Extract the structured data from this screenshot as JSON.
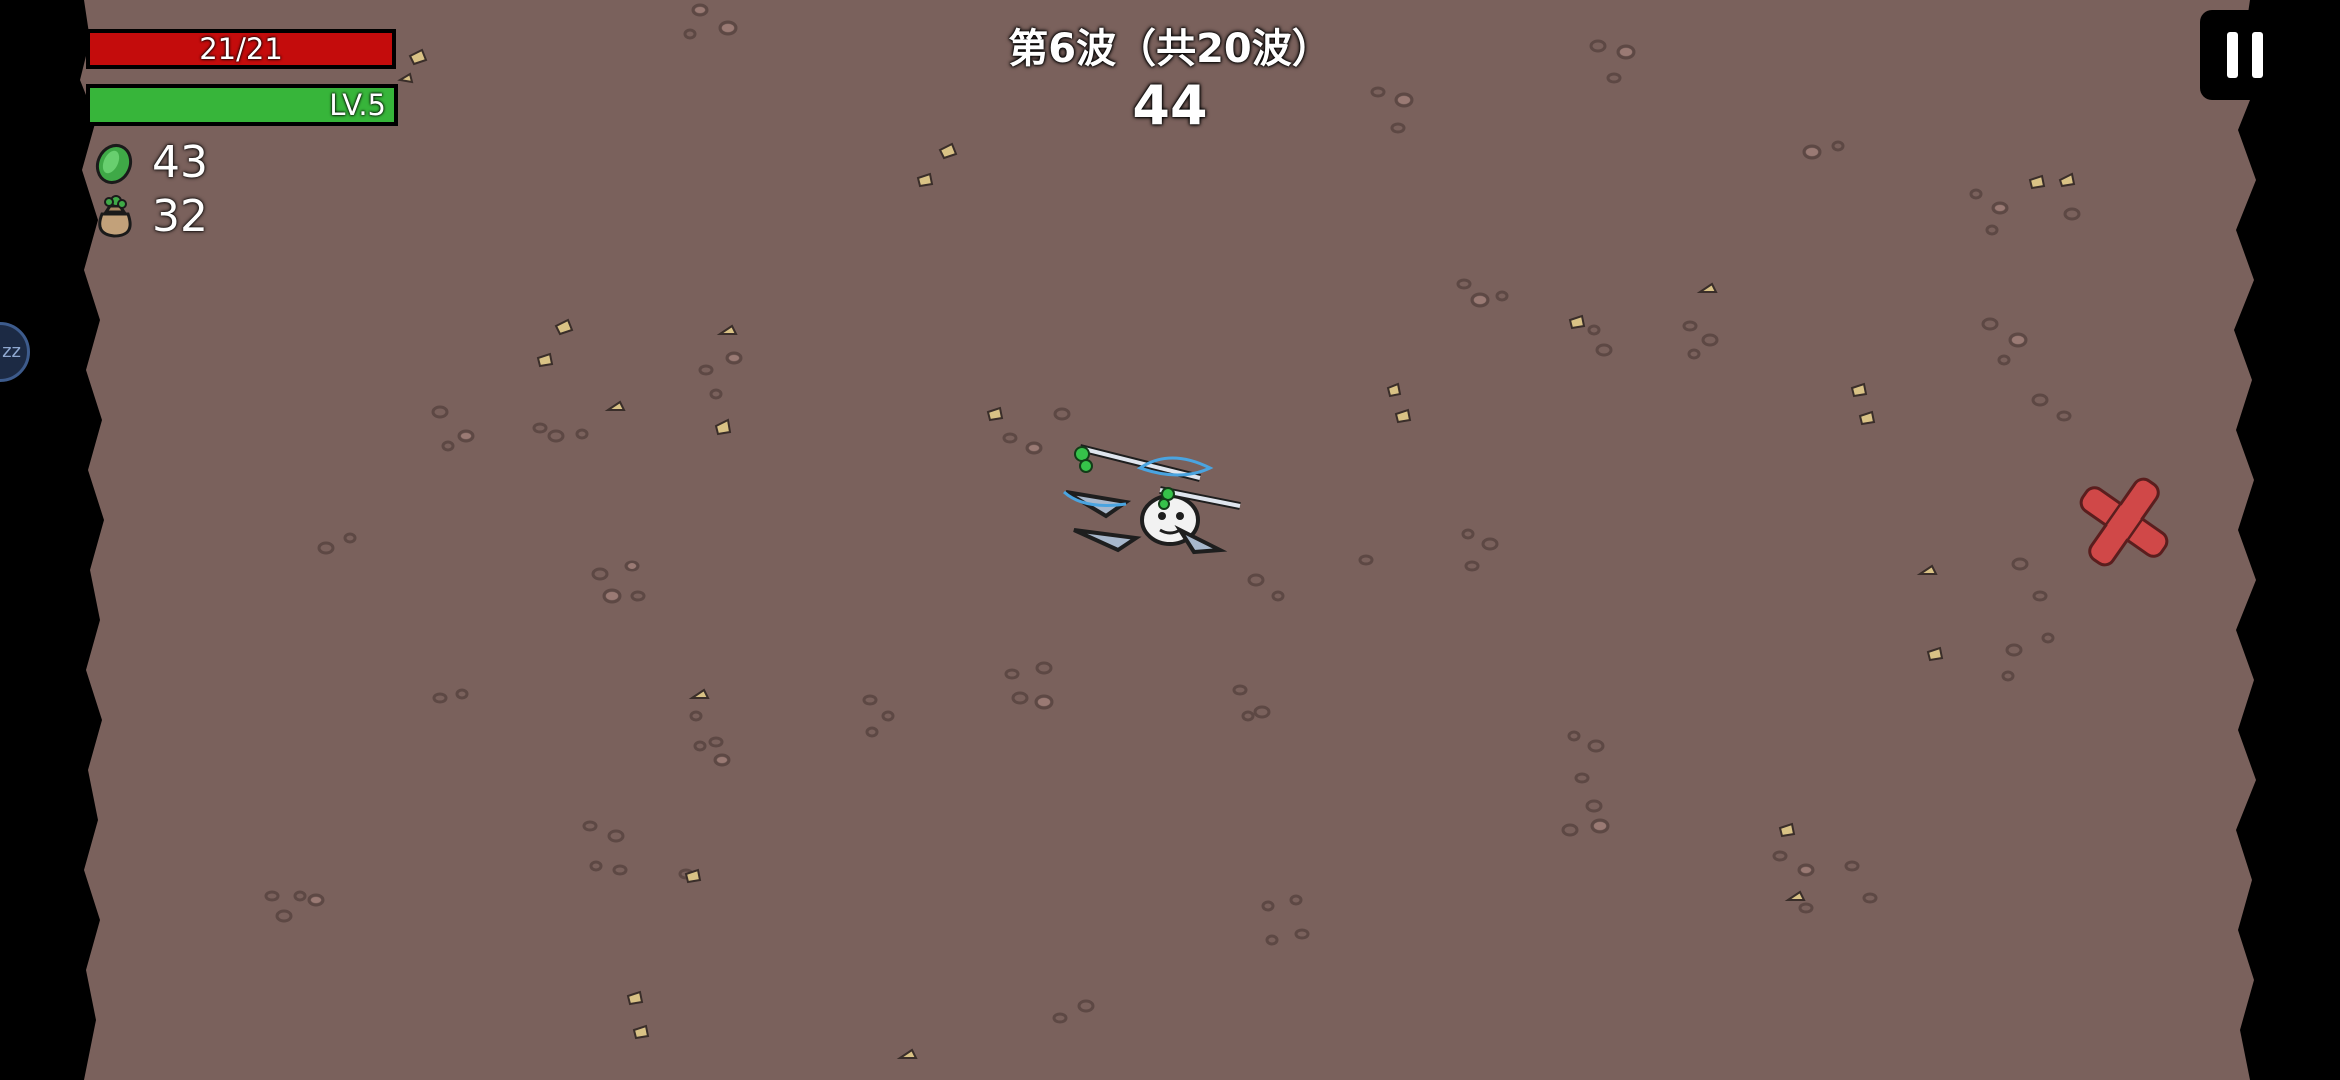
{
  "hud": {
    "hp_text": "21/21",
    "xp_text": "LV.5",
    "materials": "43",
    "bag": "32"
  },
  "wave": {
    "title": "第6波（共20波）",
    "timer": "44"
  },
  "side_bubble": {
    "text": "zz"
  },
  "colors": {
    "ground": "#7a615c",
    "hp": "#c40c0c",
    "xp": "#37b53a",
    "pebble": "#9a7a74",
    "leaf": "#d9c285",
    "spawn_marker": "#d04848"
  },
  "icons": {
    "materials": "green-material-icon",
    "bag": "money-bag-icon",
    "pause": "pause-icon",
    "enemy_spawn": "red-cross-spawn-icon"
  }
}
